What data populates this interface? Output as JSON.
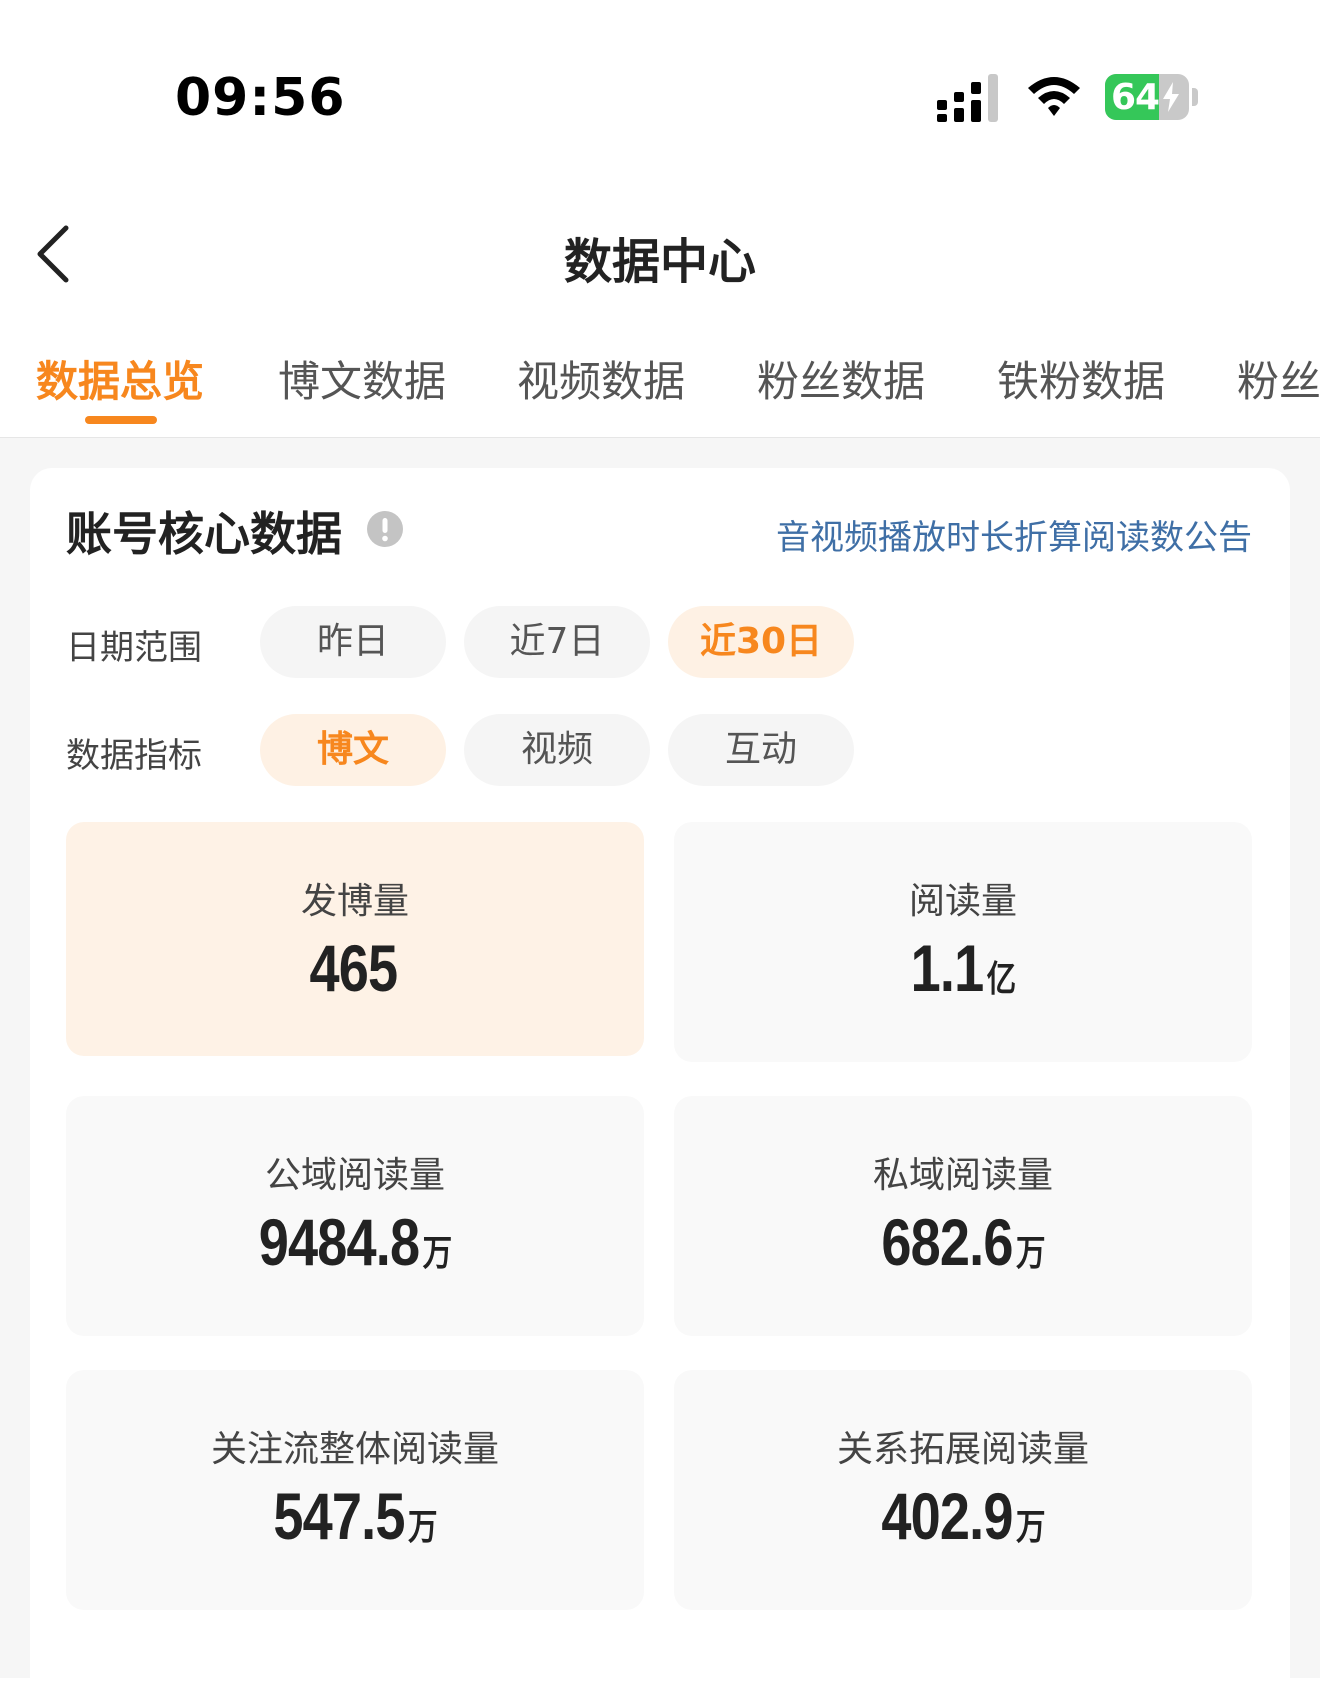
{
  "status_bar": {
    "time": "09:56",
    "battery_percent": "64",
    "battery_level": 0.64,
    "battery_color": "#35c759"
  },
  "nav": {
    "back_icon": "chevron-left-icon",
    "title": "数据中心"
  },
  "tabs": [
    {
      "label": "数据总览",
      "active": true
    },
    {
      "label": "博文数据",
      "active": false
    },
    {
      "label": "视频数据",
      "active": false
    },
    {
      "label": "粉丝数据",
      "active": false
    },
    {
      "label": "铁粉数据",
      "active": false
    },
    {
      "label": "粉丝",
      "active": false
    }
  ],
  "accent_color": "#f7871e",
  "card": {
    "title": "账号核心数据",
    "info_icon": "exclamation-circle-icon",
    "link": "音视频播放时长折算阅读数公告",
    "date_range": {
      "label": "日期范围",
      "options": [
        "昨日",
        "近7日",
        "近30日"
      ],
      "selected": "近30日"
    },
    "metric_type": {
      "label": "数据指标",
      "options": [
        "博文",
        "视频",
        "互动"
      ],
      "selected": "博文"
    },
    "metrics": [
      {
        "label": "发博量",
        "value": "465",
        "unit": "",
        "active": true
      },
      {
        "label": "阅读量",
        "value": "1.1",
        "unit": "亿",
        "active": false
      },
      {
        "label": "公域阅读量",
        "value": "9484.8",
        "unit": "万",
        "active": false
      },
      {
        "label": "私域阅读量",
        "value": "682.6",
        "unit": "万",
        "active": false
      },
      {
        "label": "关注流整体阅读量",
        "value": "547.5",
        "unit": "万",
        "active": false
      },
      {
        "label": "关系拓展阅读量",
        "value": "402.9",
        "unit": "万",
        "active": false
      }
    ]
  }
}
